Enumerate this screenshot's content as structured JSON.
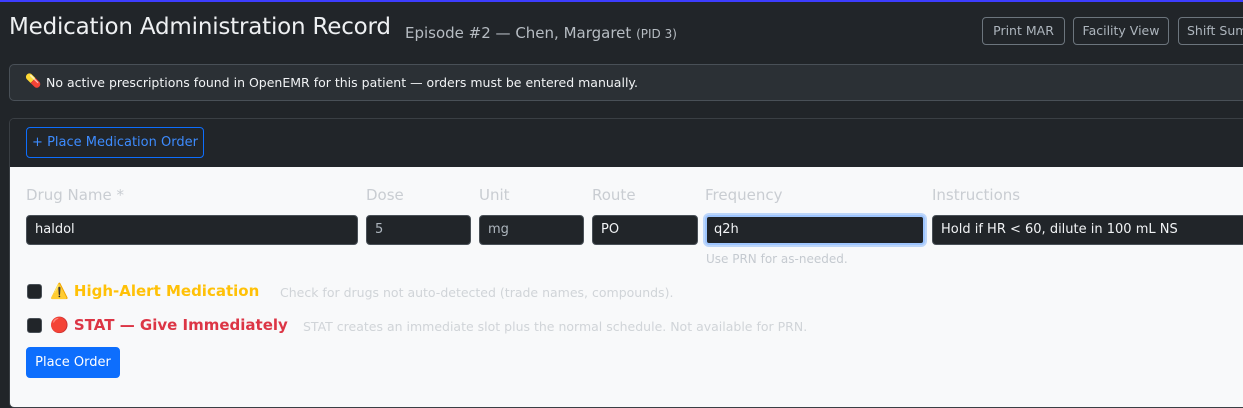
{
  "header": {
    "title": "Medication Administration Record",
    "episode": "Episode #2 — Chen, Margaret",
    "pid": "(PID 3)",
    "buttons": {
      "print": "Print MAR",
      "facility": "Facility View",
      "shift": "Shift Summary"
    }
  },
  "alert": {
    "icon": "pill-icon",
    "icon_glyph": "💊",
    "message": "No active prescriptions found in OpenEMR for this patient — orders must be entered manually."
  },
  "order_card": {
    "toggle_label": "+ Place Medication Order",
    "fields": {
      "drug_name": {
        "label": "Drug Name *",
        "value": "haldol"
      },
      "dose": {
        "label": "Dose",
        "value": "5"
      },
      "unit": {
        "label": "Unit",
        "value": "mg"
      },
      "route": {
        "label": "Route",
        "value": "PO"
      },
      "frequency": {
        "label": "Frequency",
        "value": "q2h",
        "hint": "Use PRN for as-needed."
      },
      "instructions": {
        "label": "Instructions",
        "value": "Hold if HR < 60, dilute in 100 mL NS"
      }
    },
    "high_alert": {
      "icon": "warning-icon",
      "icon_glyph": "⚠️",
      "label": "High-Alert Medication",
      "help": "Check for drugs not auto-detected (trade names, compounds).",
      "checked": false
    },
    "stat": {
      "icon": "red-circle-icon",
      "icon_glyph": "🔴",
      "label": "STAT — Give Immediately",
      "help": "STAT creates an immediate slot plus the normal schedule. Not available for PRN.",
      "checked": false
    },
    "submit_label": "Place Order"
  },
  "colors": {
    "background": "#212529",
    "accent": "#0d6efd",
    "high_alert": "#ffc107",
    "stat": "#dc3545"
  }
}
